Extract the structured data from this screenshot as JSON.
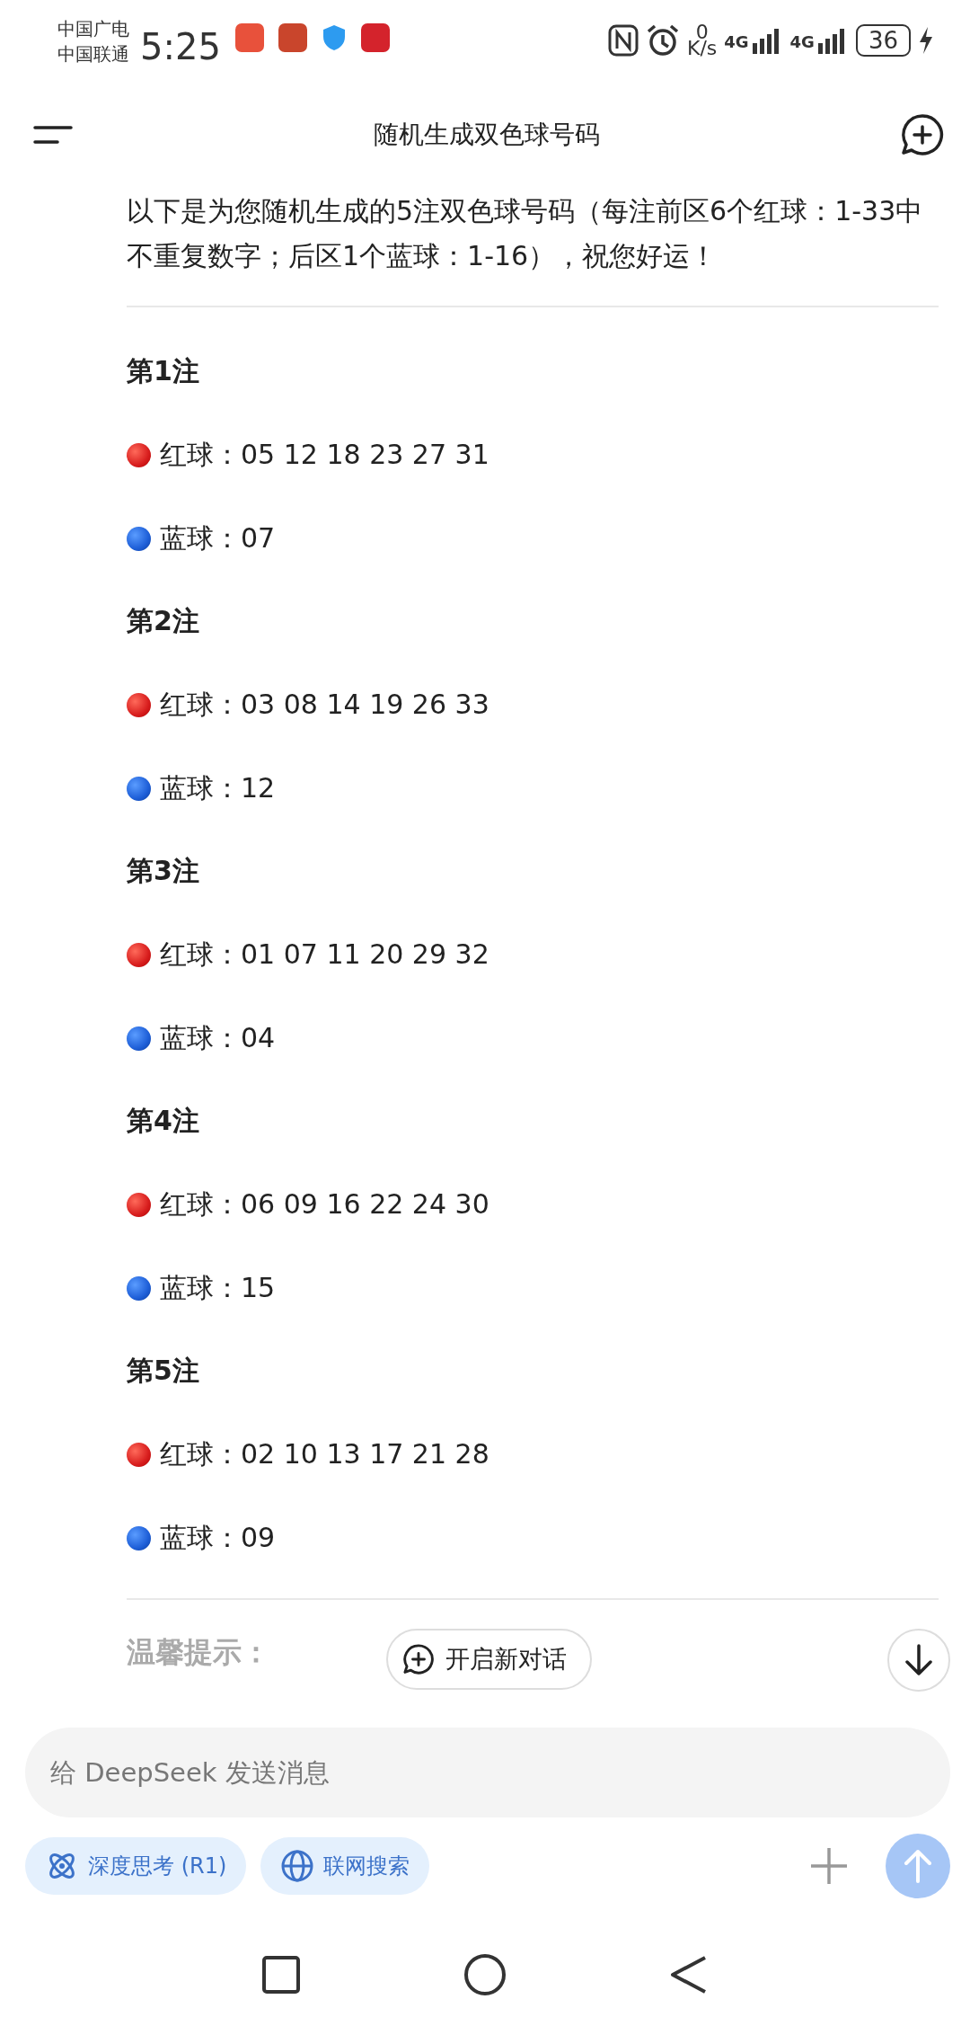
{
  "status_bar": {
    "carriers": [
      "中国广电",
      "中国联通"
    ],
    "time": "5:25",
    "speed_value": "0",
    "speed_unit": "K/s",
    "networks": [
      "4G",
      "4G"
    ],
    "battery": "36"
  },
  "header": {
    "title": "随机生成双色球号码"
  },
  "intro": "以下是为您随机生成的5注双色球号码（每注前区6个红球：1-33中不重复数字；后区1个蓝球：1-16），祝您好运！",
  "tickets": [
    {
      "title": "第1注",
      "lines": [
        {
          "kind": "red",
          "text": "红球：05 12 18 23 27 31"
        },
        {
          "kind": "blue",
          "text": "蓝球：07"
        }
      ]
    },
    {
      "title": "第2注",
      "lines": [
        {
          "kind": "red",
          "text": "红球：03 08 14 19 26 33"
        },
        {
          "kind": "blue",
          "text": "蓝球：12"
        }
      ]
    },
    {
      "title": "第3注",
      "lines": [
        {
          "kind": "red",
          "text": "红球：01 07 11 20 29 32"
        },
        {
          "kind": "blue",
          "text": "蓝球：04"
        }
      ]
    },
    {
      "title": "第4注",
      "lines": [
        {
          "kind": "red",
          "text": "红球：06 09 16 22 24 30"
        },
        {
          "kind": "blue",
          "text": "蓝球：15"
        }
      ]
    },
    {
      "title": "第5注",
      "lines": [
        {
          "kind": "red",
          "text": "红球：02 10 13 17 21 28"
        },
        {
          "kind": "blue",
          "text": "蓝球：09"
        }
      ]
    }
  ],
  "tip_heading": "温馨提示：",
  "new_chat_button": "开启新对话",
  "composer": {
    "placeholder": "给 DeepSeek 发送消息",
    "chips": [
      {
        "kind": "atom",
        "label": "深度思考 (R1)",
        "selected": false
      },
      {
        "kind": "globe",
        "label": "联网搜索",
        "selected": false
      }
    ]
  }
}
